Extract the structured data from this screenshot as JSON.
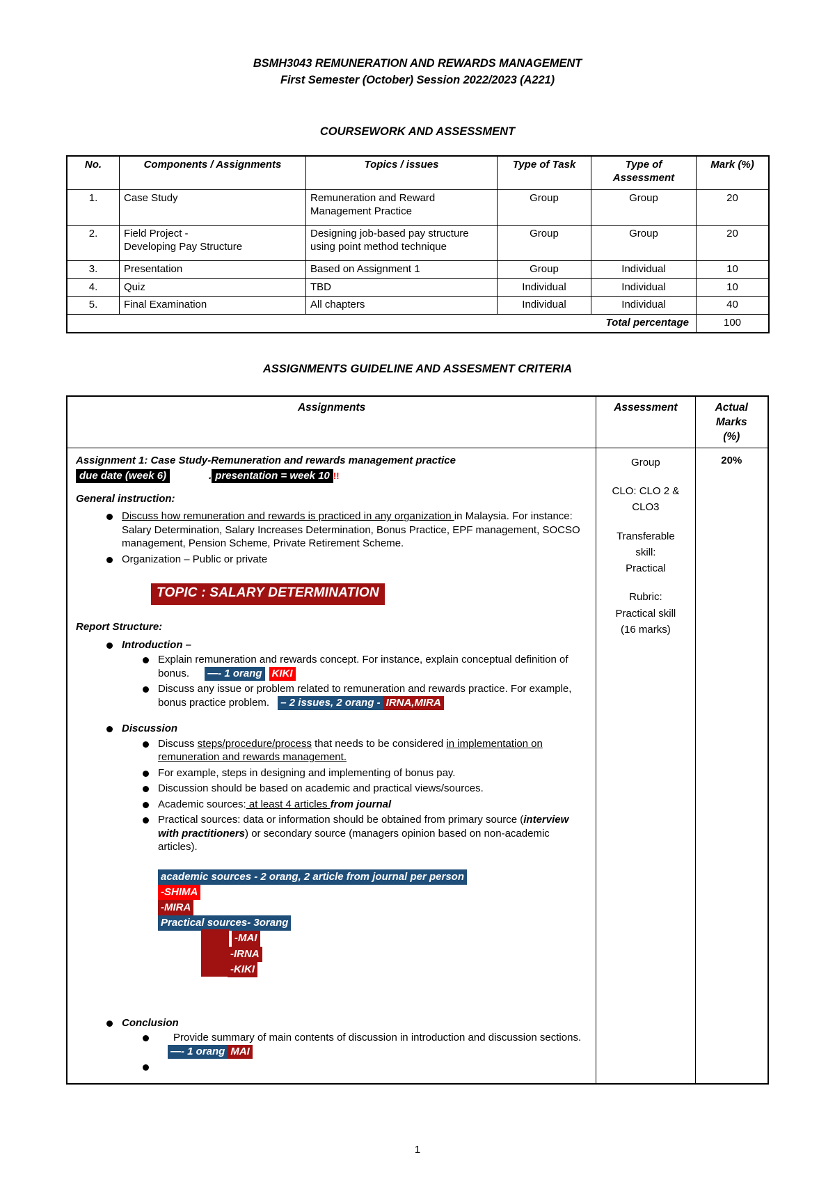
{
  "document": {
    "title_line1": "BSMH3043 REMUNERATION AND REWARDS MANAGEMENT",
    "title_line2": "First Semester (October) Session 2022/2023 (A221)",
    "section1_heading": "COURSEWORK AND ASSESSMENT",
    "section2_heading": "ASSIGNMENTS GUIDELINE AND ASSESMENT CRITERIA",
    "page_number": "1"
  },
  "coursework_table": {
    "headers": {
      "no": "No.",
      "components": "Components / Assignments",
      "topics": "Topics / issues",
      "type_of_task": "Type of Task",
      "type_of_assessment_l1": "Type of",
      "type_of_assessment_l2": "Assessment",
      "mark": "Mark (%)"
    },
    "rows": [
      {
        "no": "1.",
        "component_l1": "Case Study",
        "component_l2": "",
        "topic_l1": "Remuneration and Reward",
        "topic_l2": "Management Practice",
        "task": "Group",
        "assessment": "Group",
        "mark": "20"
      },
      {
        "no": "2.",
        "component_l1": "Field Project -",
        "component_l2": "Developing Pay Structure",
        "topic_l1": "Designing job-based pay structure",
        "topic_l2": "using point method technique",
        "task": "Group",
        "assessment": "Group",
        "mark": "20"
      },
      {
        "no": "3.",
        "component_l1": "Presentation",
        "component_l2": "",
        "topic_l1": "Based on Assignment 1",
        "topic_l2": "",
        "task": "Group",
        "assessment": "Individual",
        "mark": "10"
      },
      {
        "no": "4.",
        "component_l1": "Quiz",
        "component_l2": "",
        "topic_l1": "TBD",
        "topic_l2": "",
        "task": "Individual",
        "assessment": "Individual",
        "mark": "10"
      },
      {
        "no": "5.",
        "component_l1": "Final Examination",
        "component_l2": "",
        "topic_l1": "All chapters",
        "topic_l2": "",
        "task": "Individual",
        "assessment": "Individual",
        "mark": "40"
      }
    ],
    "total_label": "Total percentage",
    "total_value": "100"
  },
  "guideline_table": {
    "headers": {
      "assignments": "Assignments",
      "assessment": "Assessment",
      "actual_marks_l1": "Actual",
      "actual_marks_l2": "Marks",
      "actual_marks_l3": "(%)"
    },
    "assessment_cell": {
      "line1": "Group",
      "line2": "CLO: CLO 2 &",
      "line3": "CLO3",
      "line4": "Transferable",
      "line5": "skill:",
      "line6": "Practical",
      "line7": "Rubric:",
      "line8": "Practical skill",
      "line9": "(16 marks)"
    },
    "actual_marks_value": "20%",
    "assignment": {
      "title": "Assignment 1: Case Study-Remuneration and rewards management practice",
      "due_date_highlight": "due date (week 6)",
      "dot_separator": ".",
      "presentation_highlight": "presentation = week 10",
      "exclaim": "!!",
      "general_instruction_label": "General instruction:",
      "gi_bullet1_underlined": "Discuss how remuneration and rewards is practiced in any organization ",
      "gi_bullet1_rest": "in Malaysia. For instance: Salary Determination, Salary Increases Determination, Bonus Practice, EPF management, SOCSO management, Pension Scheme, Private Retirement Scheme.",
      "gi_bullet2": "Organization – Public or private",
      "topic_box": "TOPIC : SALARY DETERMINATION",
      "report_structure_label": "Report Structure:",
      "introduction_label": "Introduction –",
      "intro_b1_part1": "Explain remuneration and rewards concept.  For instance, explain conceptual definition of bonus.",
      "intro_b1_navy": "—- 1 orang",
      "intro_b1_red": "KIKI",
      "intro_b2_part1": "Discuss any issue or problem related to remuneration and rewards practice. For example, bonus practice problem.",
      "intro_b2_navy": "– 2 issues, 2 orang -",
      "intro_b2_red": "IRNA,MIRA",
      "discussion_label": "Discussion",
      "disc_b1_a": "Discuss ",
      "disc_b1_u1": "steps/procedure/process",
      "disc_b1_b": " that needs to be considered ",
      "disc_b1_u2": "in implementation on remuneration and rewards management.",
      "disc_b2": "For example, steps in designing and implementing of bonus pay.",
      "disc_b3": "Discussion should be based on academic and practical views/sources.",
      "disc_b4_a": "Academic sources:",
      "disc_b4_u": " at least 4 articles ",
      "disc_b4_b": "from journal",
      "disc_b5_a": "Practical sources: data or information should be obtained from primary source (",
      "disc_b5_bi": "interview with practitioners",
      "disc_b5_b": ") or secondary source (managers opinion based on non-academic articles).",
      "src_navy_1": "academic sources - 2 orang, 2 article from journal per person",
      "src_red_bright": "-SHIMA",
      "src_red_dark_1": "-MIRA",
      "src_navy_2": "Practical sources- 3orang",
      "src_red_dark_2": "-MAI",
      "src_red_dark_3": "-IRNA",
      "src_red_dark_4": "-KIKI",
      "conclusion_label": "Conclusion",
      "concl_b1": "Provide summary of main contents of discussion in introduction and discussion sections.",
      "concl_navy": "—- 1 orang",
      "concl_red": "MAI"
    }
  },
  "colors": {
    "highlight_black": "#000000",
    "highlight_navy": "#1F4E79",
    "highlight_red_bright": "#FF0000",
    "highlight_red_dark": "#A01212",
    "text": "#000000",
    "background": "#FFFFFF"
  }
}
